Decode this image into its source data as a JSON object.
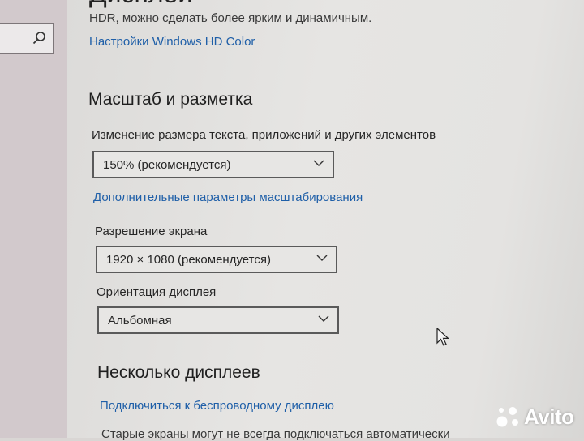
{
  "display": {
    "hdr_description": "HDR, можно сделать более ярким и динамичным.",
    "hdr_settings_link": "Настройки Windows HD Color"
  },
  "scale_layout": {
    "title": "Масштаб и разметка",
    "scale_label": "Изменение размера текста, приложений и других элементов",
    "scale_value": "150% (рекомендуется)",
    "advanced_link": "Дополнительные параметры масштабирования",
    "resolution_label": "Разрешение экрана",
    "resolution_value": "1920 × 1080 (рекомендуется)",
    "orientation_label": "Ориентация дисплея",
    "orientation_value": "Альбомная"
  },
  "multiple_displays": {
    "title": "Несколько дисплеев",
    "wireless_link": "Подключиться к беспроводному дисплею",
    "cut_off_text": "Старые экраны могут не всегда подключаться автоматически"
  },
  "watermark": {
    "text": "Avito"
  },
  "colors": {
    "link": "#1f5fa8",
    "background": "#e4e3e1",
    "dropdown_border": "#5a5a5a"
  }
}
